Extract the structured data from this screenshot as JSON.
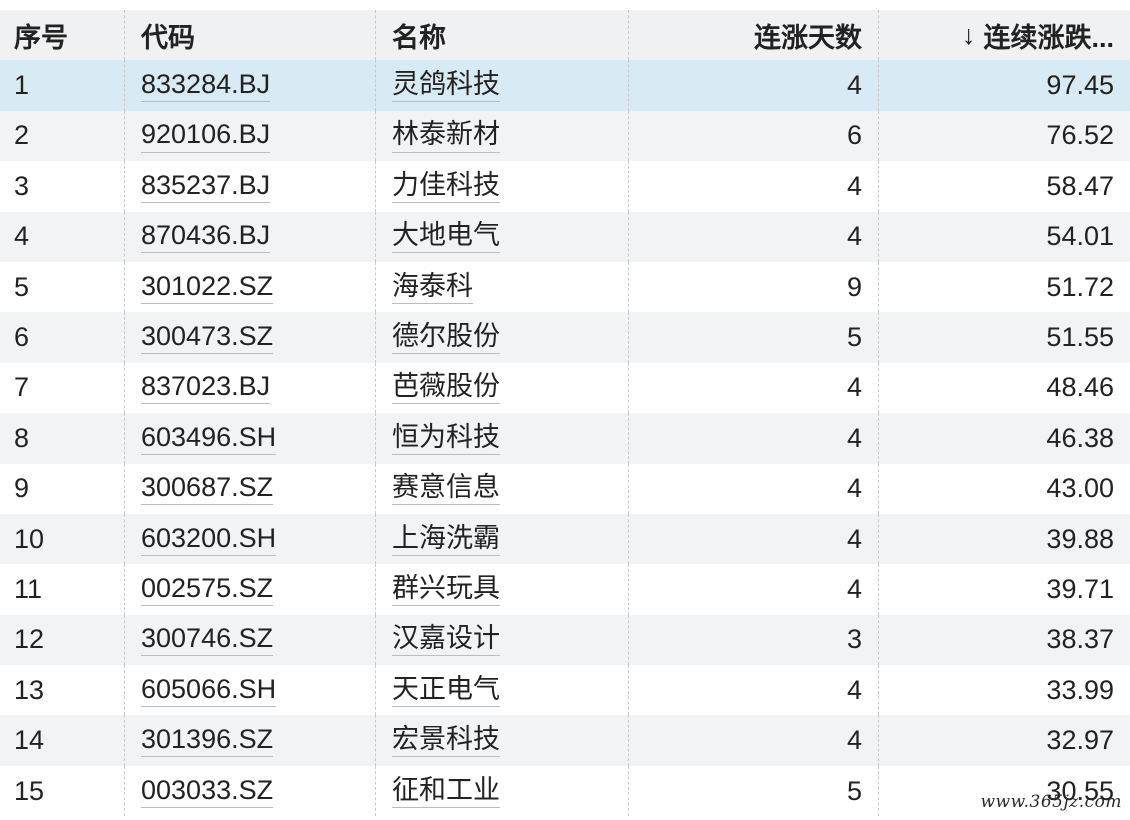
{
  "headers": {
    "index": "序号",
    "code": "代码",
    "name": "名称",
    "streak_days": "连涨天数",
    "sort_arrow": "↓",
    "cumulative_change": "连续涨跌..."
  },
  "rows": [
    {
      "index": "1",
      "code": "833284.BJ",
      "name": "灵鸽科技",
      "streak_days": "4",
      "cumulative_change": "97.45"
    },
    {
      "index": "2",
      "code": "920106.BJ",
      "name": "林泰新材",
      "streak_days": "6",
      "cumulative_change": "76.52"
    },
    {
      "index": "3",
      "code": "835237.BJ",
      "name": "力佳科技",
      "streak_days": "4",
      "cumulative_change": "58.47"
    },
    {
      "index": "4",
      "code": "870436.BJ",
      "name": "大地电气",
      "streak_days": "4",
      "cumulative_change": "54.01"
    },
    {
      "index": "5",
      "code": "301022.SZ",
      "name": "海泰科",
      "streak_days": "9",
      "cumulative_change": "51.72"
    },
    {
      "index": "6",
      "code": "300473.SZ",
      "name": "德尔股份",
      "streak_days": "5",
      "cumulative_change": "51.55"
    },
    {
      "index": "7",
      "code": "837023.BJ",
      "name": "芭薇股份",
      "streak_days": "4",
      "cumulative_change": "48.46"
    },
    {
      "index": "8",
      "code": "603496.SH",
      "name": "恒为科技",
      "streak_days": "4",
      "cumulative_change": "46.38"
    },
    {
      "index": "9",
      "code": "300687.SZ",
      "name": "赛意信息",
      "streak_days": "4",
      "cumulative_change": "43.00"
    },
    {
      "index": "10",
      "code": "603200.SH",
      "name": "上海洗霸",
      "streak_days": "4",
      "cumulative_change": "39.88"
    },
    {
      "index": "11",
      "code": "002575.SZ",
      "name": "群兴玩具",
      "streak_days": "4",
      "cumulative_change": "39.71"
    },
    {
      "index": "12",
      "code": "300746.SZ",
      "name": "汉嘉设计",
      "streak_days": "3",
      "cumulative_change": "38.37"
    },
    {
      "index": "13",
      "code": "605066.SH",
      "name": "天正电气",
      "streak_days": "4",
      "cumulative_change": "33.99"
    },
    {
      "index": "14",
      "code": "301396.SZ",
      "name": "宏景科技",
      "streak_days": "4",
      "cumulative_change": "32.97"
    },
    {
      "index": "15",
      "code": "003033.SZ",
      "name": "征和工业",
      "streak_days": "5",
      "cumulative_change": "30.55"
    }
  ],
  "watermark": "www.365jz.com"
}
